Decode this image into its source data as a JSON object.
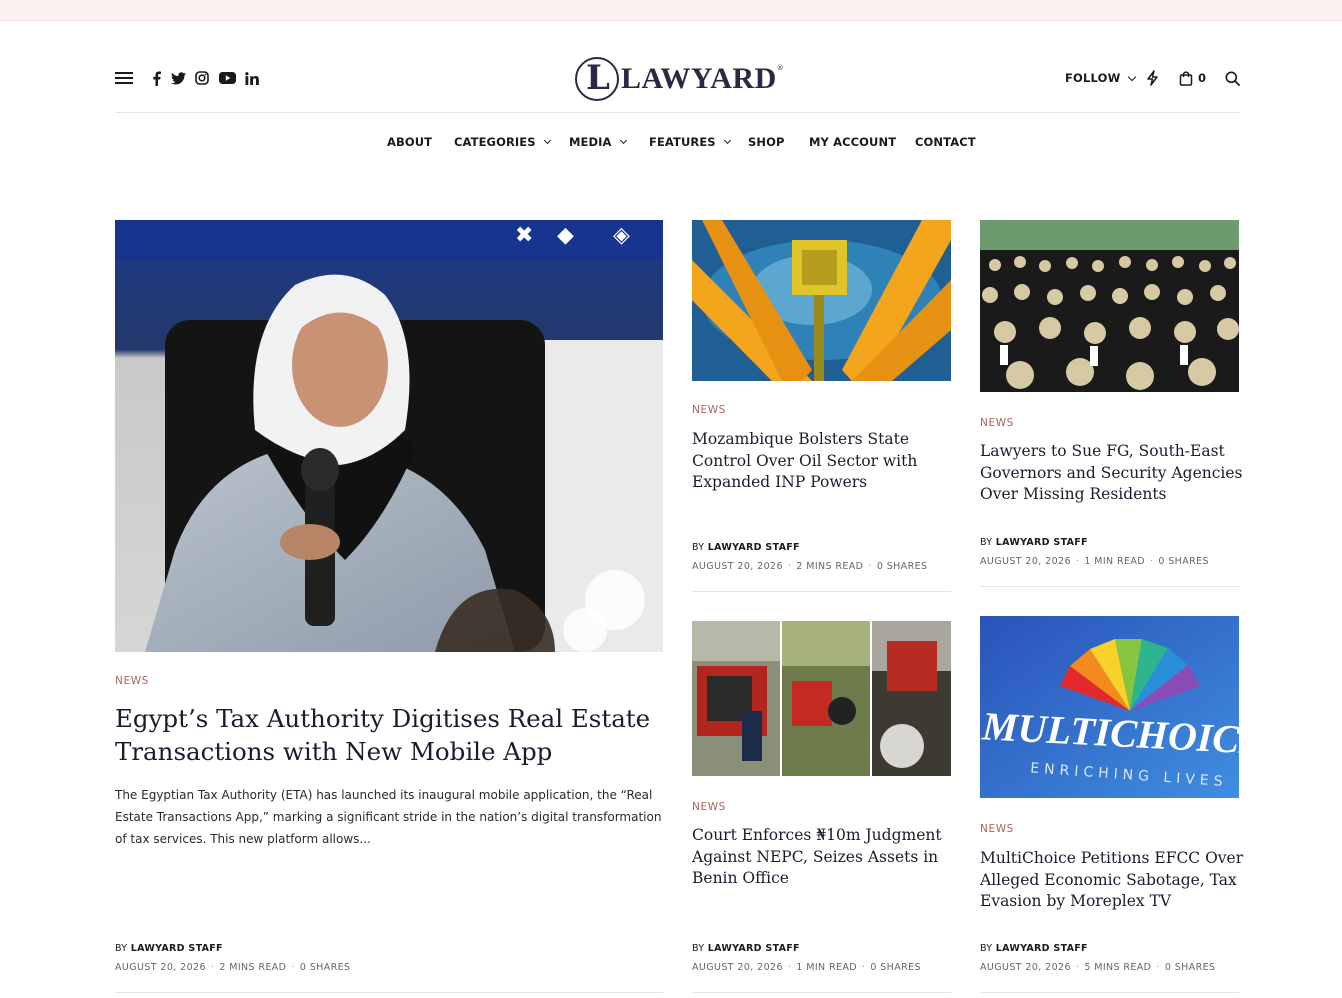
{
  "header": {
    "logo_text": "LAWYARD",
    "logo_reg": "®",
    "follow_label": "FOLLOW",
    "cart_count": "0",
    "social_icons": [
      "facebook-icon",
      "twitter-icon",
      "instagram-icon",
      "youtube-icon",
      "linkedin-icon"
    ]
  },
  "nav": {
    "items": [
      {
        "label": "ABOUT",
        "dropdown": false
      },
      {
        "label": "CATEGORIES",
        "dropdown": true
      },
      {
        "label": "MEDIA",
        "dropdown": true
      },
      {
        "label": "FEATURES",
        "dropdown": true
      },
      {
        "label": "SHOP",
        "dropdown": false
      },
      {
        "label": "MY ACCOUNT",
        "dropdown": false
      },
      {
        "label": "CONTACT",
        "dropdown": false
      }
    ]
  },
  "featured": {
    "category": "NEWS",
    "title": "Egypt’s Tax Authority Digitises Real Estate Transactions with New Mobile App",
    "excerpt": "The Egyptian Tax Authority (ETA) has launched its inaugural mobile application, the “Real Estate Transactions App,” marking a significant stride in the nation’s digital transformation of tax services. This new platform allows...",
    "by_prefix": "BY",
    "author": "LAWYARD STAFF",
    "date": "AUGUST 20, 2026",
    "read_time": "2 MINS READ",
    "shares": "0 SHARES"
  },
  "articles": [
    {
      "category": "NEWS",
      "title": "Mozambique Bolsters State Control Over Oil Sector with Expanded INP Powers",
      "by_prefix": "BY",
      "author": "LAWYARD STAFF",
      "date": "AUGUST 20, 2026",
      "read_time": "2 MINS READ",
      "shares": "0 SHARES"
    },
    {
      "category": "NEWS",
      "title": "Lawyers to Sue FG, South-East Governors and Security Agencies Over Missing Residents",
      "by_prefix": "BY",
      "author": "LAWYARD STAFF",
      "date": "AUGUST 20, 2026",
      "read_time": "1 MIN READ",
      "shares": "0 SHARES"
    },
    {
      "category": "NEWS",
      "title": "Court Enforces ₦10m Judgment Against NEPC, Seizes Assets in Benin Office",
      "by_prefix": "BY",
      "author": "LAWYARD STAFF",
      "date": "AUGUST 20, 2026",
      "read_time": "1 MIN READ",
      "shares": "0 SHARES"
    },
    {
      "category": "NEWS",
      "title": "MultiChoice Petitions EFCC Over Alleged Economic Sabotage, Tax Evasion by Moreplex TV",
      "by_prefix": "BY",
      "author": "LAWYARD STAFF",
      "date": "AUGUST 20, 2026",
      "read_time": "5 MINS READ",
      "shares": "0 SHARES"
    }
  ],
  "multichoice_sign": {
    "brand": "MULTICHOICE",
    "tagline": "ENRICHING LIVES"
  }
}
